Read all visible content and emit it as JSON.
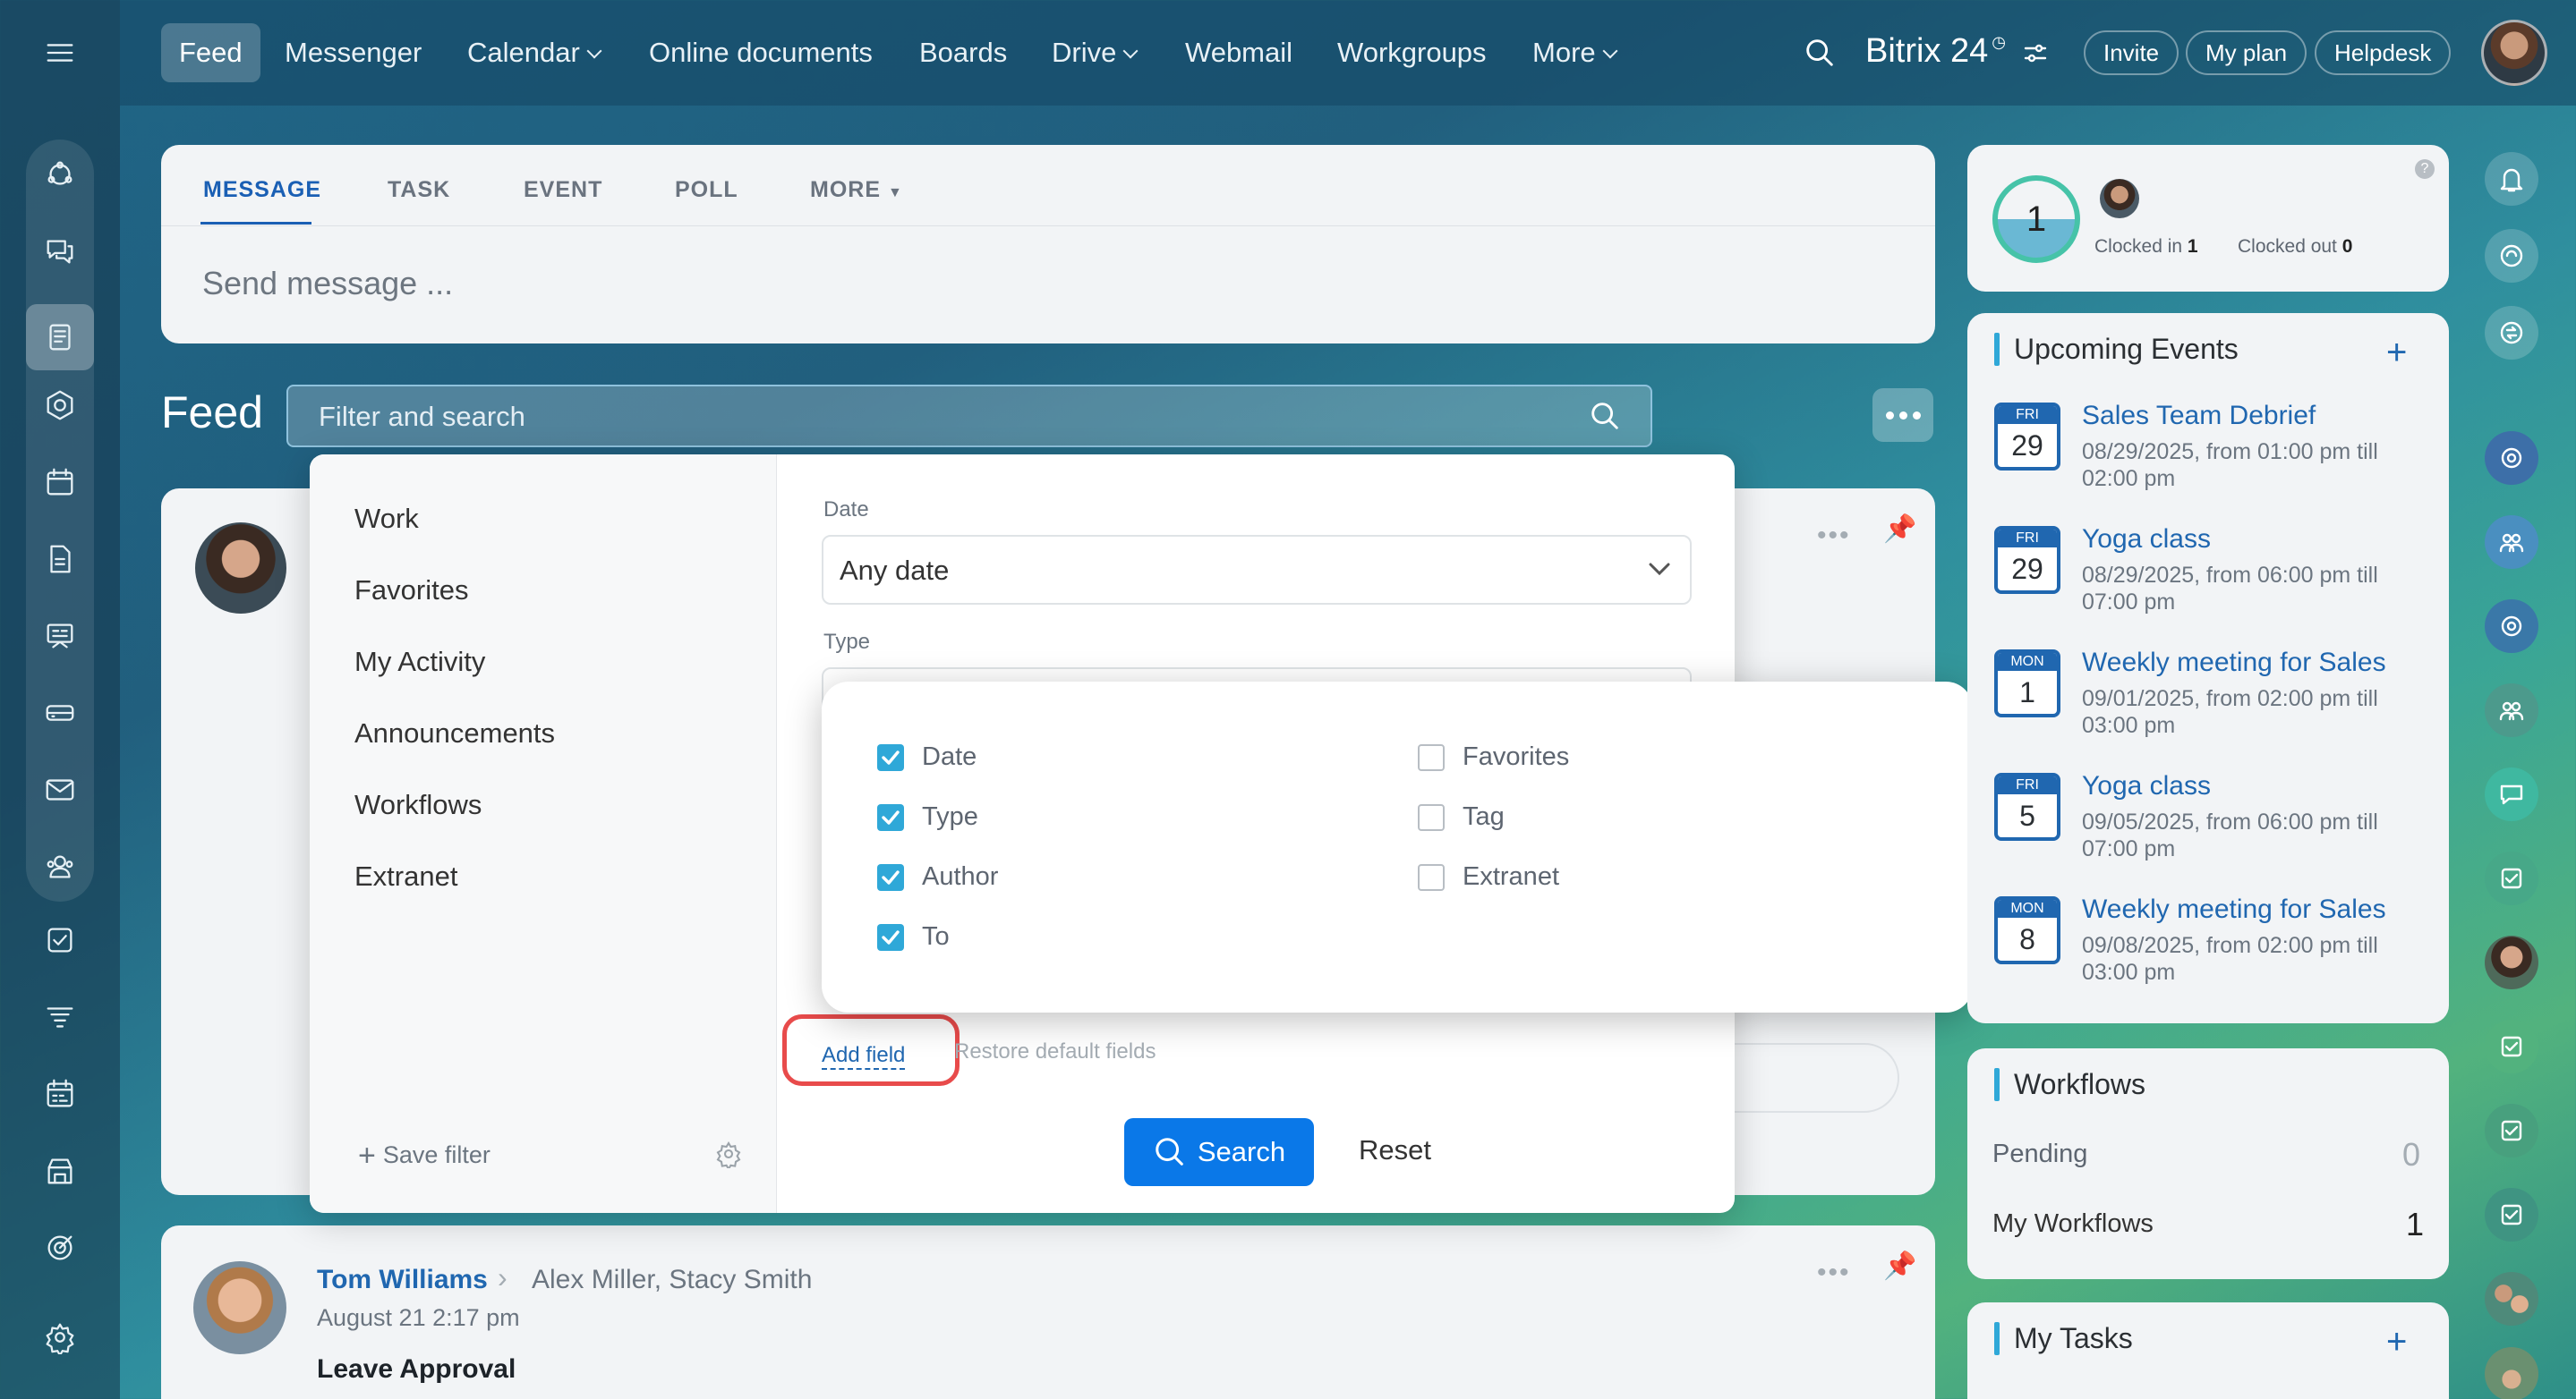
{
  "topnav": {
    "items": [
      {
        "label": "Feed"
      },
      {
        "label": "Messenger"
      },
      {
        "label": "Calendar"
      },
      {
        "label": "Online documents"
      },
      {
        "label": "Boards"
      },
      {
        "label": "Drive"
      },
      {
        "label": "Webmail"
      },
      {
        "label": "Workgroups"
      },
      {
        "label": "More"
      }
    ],
    "brand": "Bitrix 24",
    "invite": "Invite",
    "my_plan": "My plan",
    "helpdesk": "Helpdesk"
  },
  "composer": {
    "tabs": [
      {
        "label": "MESSAGE"
      },
      {
        "label": "TASK"
      },
      {
        "label": "EVENT"
      },
      {
        "label": "POLL"
      },
      {
        "label": "MORE"
      }
    ],
    "placeholder": "Send message ..."
  },
  "feed": {
    "title": "Feed",
    "search_placeholder": "Filter and search"
  },
  "filter": {
    "presets": [
      {
        "label": "Work"
      },
      {
        "label": "Favorites"
      },
      {
        "label": "My Activity"
      },
      {
        "label": "Announcements"
      },
      {
        "label": "Workflows"
      },
      {
        "label": "Extranet"
      }
    ],
    "save_filter": "Save filter",
    "date_label": "Date",
    "date_value": "Any date",
    "type_label": "Type",
    "add_field": "Add field",
    "restore_defaults": "Restore default fields",
    "search_button": "Search",
    "reset_button": "Reset"
  },
  "field_chooser": {
    "left": [
      {
        "label": "Date",
        "checked": true
      },
      {
        "label": "Type",
        "checked": true
      },
      {
        "label": "Author",
        "checked": true
      },
      {
        "label": "To",
        "checked": true
      }
    ],
    "right": [
      {
        "label": "Favorites",
        "checked": false
      },
      {
        "label": "Tag",
        "checked": false
      },
      {
        "label": "Extranet",
        "checked": false
      }
    ]
  },
  "post": {
    "author": "Tom Williams",
    "recipients": "Alex Miller, Stacy Smith",
    "date": "August 21 2:17 pm",
    "title": "Leave Approval"
  },
  "timeman": {
    "count": "1",
    "clocked_in_label": "Clocked in",
    "clocked_in_value": "1",
    "clocked_out_label": "Clocked out",
    "clocked_out_value": "0"
  },
  "upcoming_events": {
    "title": "Upcoming Events",
    "items": [
      {
        "dow": "FRI",
        "day": "29",
        "title": "Sales Team Debrief",
        "time": "08/29/2025, from 01:00 pm till 02:00 pm"
      },
      {
        "dow": "FRI",
        "day": "29",
        "title": "Yoga class",
        "time": "08/29/2025, from 06:00 pm till 07:00 pm"
      },
      {
        "dow": "MON",
        "day": "1",
        "title": "Weekly meeting for Sales",
        "time": "09/01/2025, from 02:00 pm till 03:00 pm"
      },
      {
        "dow": "FRI",
        "day": "5",
        "title": "Yoga class",
        "time": "09/05/2025, from 06:00 pm till 07:00 pm"
      },
      {
        "dow": "MON",
        "day": "8",
        "title": "Weekly meeting for Sales",
        "time": "09/08/2025, from 02:00 pm till 03:00 pm"
      }
    ]
  },
  "workflows": {
    "title": "Workflows",
    "pending_label": "Pending",
    "pending_value": "0",
    "mine_label": "My Workflows",
    "mine_value": "1"
  },
  "tasks": {
    "title": "My Tasks"
  },
  "colors": {
    "accent": "#2067b0",
    "primary_button": "#0a78e8",
    "checkbox": "#2fa8d8",
    "highlight": "#e84b4b"
  }
}
